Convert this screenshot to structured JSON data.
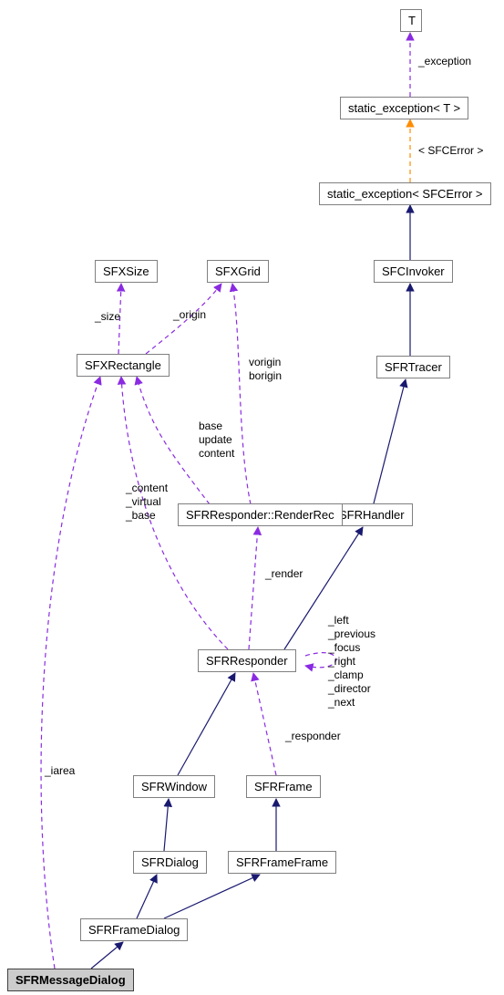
{
  "chart_data": {
    "type": "graph",
    "title": "",
    "nodes": [
      {
        "id": "T",
        "label": "T"
      },
      {
        "id": "static_exception_T",
        "label": "static_exception< T >"
      },
      {
        "id": "static_exception_E",
        "label": "static_exception< SFCError >"
      },
      {
        "id": "SFCInvoker",
        "label": "SFCInvoker"
      },
      {
        "id": "SFRTracer",
        "label": "SFRTracer"
      },
      {
        "id": "SFRHandler",
        "label": "SFRHandler"
      },
      {
        "id": "SFXSize",
        "label": "SFXSize"
      },
      {
        "id": "SFXGrid",
        "label": "SFXGrid"
      },
      {
        "id": "SFXRectangle",
        "label": "SFXRectangle"
      },
      {
        "id": "RenderRec",
        "label": "SFRResponder::RenderRec"
      },
      {
        "id": "SFRResponder",
        "label": "SFRResponder"
      },
      {
        "id": "SFRWindow",
        "label": "SFRWindow"
      },
      {
        "id": "SFRFrame",
        "label": "SFRFrame"
      },
      {
        "id": "SFRDialog",
        "label": "SFRDialog"
      },
      {
        "id": "SFRFrameFrame",
        "label": "SFRFrameFrame"
      },
      {
        "id": "SFRFrameDialog",
        "label": "SFRFrameDialog"
      },
      {
        "id": "SFRMessageDialog",
        "label": "SFRMessageDialog"
      }
    ],
    "edges": [
      {
        "from": "static_exception_T",
        "to": "T",
        "style": "dashed",
        "color": "purple",
        "label": "_exception"
      },
      {
        "from": "static_exception_E",
        "to": "static_exception_T",
        "style": "dashed",
        "color": "orange",
        "label": "< SFCError >"
      },
      {
        "from": "SFCInvoker",
        "to": "static_exception_E",
        "style": "solid",
        "color": "navy",
        "label": ""
      },
      {
        "from": "SFRTracer",
        "to": "SFCInvoker",
        "style": "solid",
        "color": "navy",
        "label": ""
      },
      {
        "from": "SFRHandler",
        "to": "SFRTracer",
        "style": "solid",
        "color": "navy",
        "label": ""
      },
      {
        "from": "SFRResponder",
        "to": "SFRHandler",
        "style": "solid",
        "color": "navy",
        "label": ""
      },
      {
        "from": "SFRResponder",
        "to": "SFRResponder",
        "style": "dashed",
        "color": "purple",
        "label": "_left\n_previous\n_focus\n_right\n_clamp\n_director\n_next"
      },
      {
        "from": "SFRResponder",
        "to": "RenderRec",
        "style": "dashed",
        "color": "purple",
        "label": "_render"
      },
      {
        "from": "RenderRec",
        "to": "SFXRectangle",
        "style": "dashed",
        "color": "purple",
        "label": "base\nupdate\ncontent"
      },
      {
        "from": "RenderRec",
        "to": "SFXGrid",
        "style": "dashed",
        "color": "purple",
        "label": "vorigin\nborigin"
      },
      {
        "from": "SFXRectangle",
        "to": "SFXSize",
        "style": "dashed",
        "color": "purple",
        "label": "_size"
      },
      {
        "from": "SFXRectangle",
        "to": "SFXGrid",
        "style": "dashed",
        "color": "purple",
        "label": "_origin"
      },
      {
        "from": "SFRResponder",
        "to": "SFXRectangle",
        "style": "dashed",
        "color": "purple",
        "label": "_content\n_virtual\n_base"
      },
      {
        "from": "SFRFrame",
        "to": "SFRResponder",
        "style": "dashed",
        "color": "purple",
        "label": "_responder"
      },
      {
        "from": "SFRWindow",
        "to": "SFRResponder",
        "style": "solid",
        "color": "navy",
        "label": ""
      },
      {
        "from": "SFRDialog",
        "to": "SFRWindow",
        "style": "solid",
        "color": "navy",
        "label": ""
      },
      {
        "from": "SFRFrameFrame",
        "to": "SFRFrame",
        "style": "solid",
        "color": "navy",
        "label": ""
      },
      {
        "from": "SFRFrameDialog",
        "to": "SFRDialog",
        "style": "solid",
        "color": "navy",
        "label": ""
      },
      {
        "from": "SFRFrameDialog",
        "to": "SFRFrameFrame",
        "style": "solid",
        "color": "navy",
        "label": ""
      },
      {
        "from": "SFRMessageDialog",
        "to": "SFRFrameDialog",
        "style": "solid",
        "color": "navy",
        "label": ""
      },
      {
        "from": "SFRMessageDialog",
        "to": "SFXRectangle",
        "style": "dashed",
        "color": "purple",
        "label": "_iarea"
      }
    ]
  },
  "nodes": {
    "T": {
      "label": "T"
    },
    "static_exception_T": {
      "label": "static_exception< T >"
    },
    "static_exception_E": {
      "label": "static_exception< SFCError >"
    },
    "SFCInvoker": {
      "label": "SFCInvoker"
    },
    "SFRTracer": {
      "label": "SFRTracer"
    },
    "SFRHandler": {
      "label": "SFRHandler"
    },
    "SFXSize": {
      "label": "SFXSize"
    },
    "SFXGrid": {
      "label": "SFXGrid"
    },
    "SFXRectangle": {
      "label": "SFXRectangle"
    },
    "RenderRec": {
      "label": "SFRResponder::RenderRec"
    },
    "SFRResponder": {
      "label": "SFRResponder"
    },
    "SFRWindow": {
      "label": "SFRWindow"
    },
    "SFRFrame": {
      "label": "SFRFrame"
    },
    "SFRDialog": {
      "label": "SFRDialog"
    },
    "SFRFrameFrame": {
      "label": "SFRFrameFrame"
    },
    "SFRFrameDialog": {
      "label": "SFRFrameDialog"
    },
    "SFRMessageDialog": {
      "label": "SFRMessageDialog"
    }
  },
  "edgeLabels": {
    "exception": "_exception",
    "sfcerror": "< SFCError >",
    "size": "_size",
    "origin": "_origin",
    "vorigin": "vorigin\nborigin",
    "base": "base\nupdate\ncontent",
    "cvb": "_content\n_virtual\n_base",
    "render": "_render",
    "selfloop": "_left\n_previous\n_focus\n_right\n_clamp\n_director\n_next",
    "responder": "_responder",
    "iarea": "_iarea"
  }
}
